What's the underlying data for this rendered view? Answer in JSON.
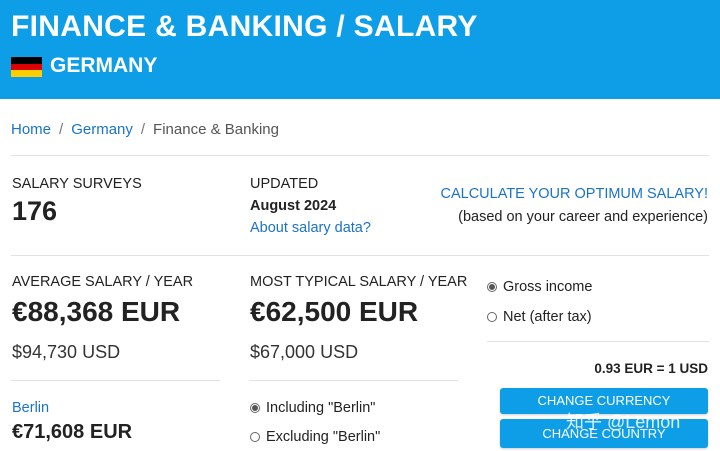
{
  "header": {
    "title": "FINANCE & BANKING / SALARY",
    "country": "GERMANY"
  },
  "breadcrumb": {
    "home": "Home",
    "country": "Germany",
    "current": "Finance & Banking",
    "separator": "/"
  },
  "surveys": {
    "label": "SALARY SURVEYS",
    "value": "176"
  },
  "updated": {
    "label": "UPDATED",
    "date": "August 2024",
    "about_link": "About salary data?"
  },
  "calculate": {
    "link": "CALCULATE YOUR OPTIMUM SALARY!",
    "subtitle": "(based on your career and experience)"
  },
  "average": {
    "label": "AVERAGE SALARY / YEAR",
    "eur": "€88,368 EUR",
    "usd": "$94,730 USD"
  },
  "typical": {
    "label": "MOST TYPICAL SALARY / YEAR",
    "eur": "€62,500 EUR",
    "usd": "$67,000 USD"
  },
  "income_type": {
    "gross": "Gross income",
    "net": "Net (after tax)",
    "selected": "gross"
  },
  "exchange_rate": "0.93 EUR = 1 USD",
  "city": {
    "link": "Berlin",
    "eur": "€71,608 EUR"
  },
  "city_filter": {
    "include": "Including \"Berlin\"",
    "exclude": "Excluding \"Berlin\"",
    "selected": "include"
  },
  "buttons": {
    "change_currency": "CHANGE CURRENCY",
    "change_country": "CHANGE COUNTRY"
  },
  "watermark": "知乎 @Lemon",
  "colors": {
    "header_bg": "#0e9ee8",
    "link": "#1a73c9",
    "flag": [
      "#000000",
      "#dd0000",
      "#ffce00"
    ]
  }
}
